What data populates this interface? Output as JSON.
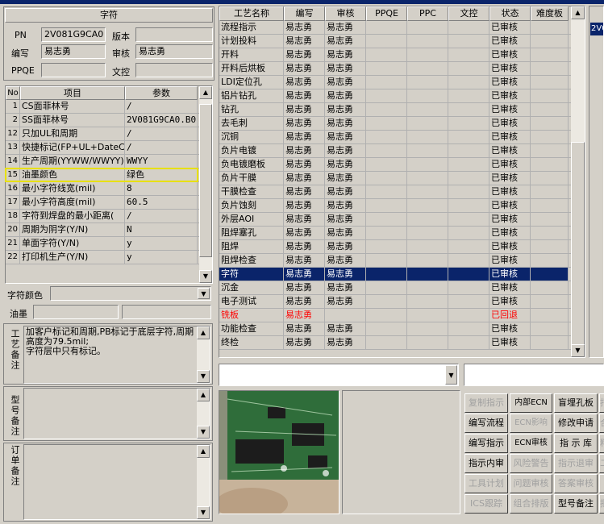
{
  "left_panel": {
    "title": "字符",
    "pn_label": "PN",
    "pn_value": "2V081G9CA0",
    "version_label": "版本",
    "version_value": "",
    "author_label": "编写",
    "author_value": "易志勇",
    "reviewer_label": "审核",
    "reviewer_value": "易志勇",
    "ppqe_label": "PPQE",
    "ppqe_value": "",
    "doc_control_label": "文控",
    "doc_control_value": ""
  },
  "param_table": {
    "headers": [
      "No",
      "项目",
      "参数"
    ],
    "rows": [
      {
        "no": "1",
        "item": "CS面菲林号",
        "value": "/"
      },
      {
        "no": "2",
        "item": "SS面菲林号",
        "value": "2V081G9CA0.B0"
      },
      {
        "no": "12",
        "item": "只加UL和周期",
        "value": "/"
      },
      {
        "no": "13",
        "item": "快捷标记(FP+UL+DateCo",
        "value": "/"
      },
      {
        "no": "14",
        "item": "生产周期(YYWW/WWYY)",
        "value": "WWYY"
      },
      {
        "no": "15",
        "item": "油墨颜色",
        "value": "绿色"
      },
      {
        "no": "16",
        "item": "最小字符线宽(mil)",
        "value": "8"
      },
      {
        "no": "17",
        "item": "最小字符高度(mil)",
        "value": "60.5"
      },
      {
        "no": "18",
        "item": "字符到焊盘的最小距离(",
        "value": "/"
      },
      {
        "no": "20",
        "item": "周期为阴字(Y/N)",
        "value": "N"
      },
      {
        "no": "21",
        "item": "单面字符(Y/N)",
        "value": "y"
      },
      {
        "no": "22",
        "item": "打印机生产(Y/N)",
        "value": "y"
      }
    ],
    "highlight_color": "#e8e000"
  },
  "char_color_label": "字符颜色",
  "char_color_value": "",
  "ink_label": "油墨",
  "ink_value_1": "",
  "ink_value_2": "",
  "process_note_label": "工艺备注",
  "process_note_text": "加客户标记和周期,PB标记于底层字符,周期高度为79.5mil;\n字符层中只有标记。",
  "model_note_label": "型号备注",
  "model_note_text": "",
  "order_note_label": "订单备注",
  "order_note_text": "",
  "process_table": {
    "headers": [
      "工艺名称",
      "编写",
      "审核",
      "PPQE",
      "PPC",
      "文控",
      "状态",
      "难度板"
    ],
    "rows": [
      {
        "name": "流程指示",
        "author": "易志勇",
        "reviewer": "易志勇",
        "ppqe": "",
        "ppc": "",
        "doc": "",
        "status": "已审核",
        "diff": "",
        "state": "normal"
      },
      {
        "name": "计划投料",
        "author": "易志勇",
        "reviewer": "易志勇",
        "ppqe": "",
        "ppc": "",
        "doc": "",
        "status": "已审核",
        "diff": "",
        "state": "normal"
      },
      {
        "name": "开料",
        "author": "易志勇",
        "reviewer": "易志勇",
        "ppqe": "",
        "ppc": "",
        "doc": "",
        "status": "已审核",
        "diff": "",
        "state": "normal"
      },
      {
        "name": "开料后烘板",
        "author": "易志勇",
        "reviewer": "易志勇",
        "ppqe": "",
        "ppc": "",
        "doc": "",
        "status": "已审核",
        "diff": "",
        "state": "normal"
      },
      {
        "name": "LDI定位孔",
        "author": "易志勇",
        "reviewer": "易志勇",
        "ppqe": "",
        "ppc": "",
        "doc": "",
        "status": "已审核",
        "diff": "",
        "state": "normal"
      },
      {
        "name": "铝片钻孔",
        "author": "易志勇",
        "reviewer": "易志勇",
        "ppqe": "",
        "ppc": "",
        "doc": "",
        "status": "已审核",
        "diff": "",
        "state": "normal"
      },
      {
        "name": "钻孔",
        "author": "易志勇",
        "reviewer": "易志勇",
        "ppqe": "",
        "ppc": "",
        "doc": "",
        "status": "已审核",
        "diff": "",
        "state": "normal"
      },
      {
        "name": "去毛刺",
        "author": "易志勇",
        "reviewer": "易志勇",
        "ppqe": "",
        "ppc": "",
        "doc": "",
        "status": "已审核",
        "diff": "",
        "state": "normal"
      },
      {
        "name": "沉铜",
        "author": "易志勇",
        "reviewer": "易志勇",
        "ppqe": "",
        "ppc": "",
        "doc": "",
        "status": "已审核",
        "diff": "",
        "state": "normal"
      },
      {
        "name": "负片电镀",
        "author": "易志勇",
        "reviewer": "易志勇",
        "ppqe": "",
        "ppc": "",
        "doc": "",
        "status": "已审核",
        "diff": "",
        "state": "normal"
      },
      {
        "name": "负电镀磨板",
        "author": "易志勇",
        "reviewer": "易志勇",
        "ppqe": "",
        "ppc": "",
        "doc": "",
        "status": "已审核",
        "diff": "",
        "state": "normal"
      },
      {
        "name": "负片干膜",
        "author": "易志勇",
        "reviewer": "易志勇",
        "ppqe": "",
        "ppc": "",
        "doc": "",
        "status": "已审核",
        "diff": "",
        "state": "normal"
      },
      {
        "name": "干膜检查",
        "author": "易志勇",
        "reviewer": "易志勇",
        "ppqe": "",
        "ppc": "",
        "doc": "",
        "status": "已审核",
        "diff": "",
        "state": "normal"
      },
      {
        "name": "负片蚀刻",
        "author": "易志勇",
        "reviewer": "易志勇",
        "ppqe": "",
        "ppc": "",
        "doc": "",
        "status": "已审核",
        "diff": "",
        "state": "normal"
      },
      {
        "name": "外层AOI",
        "author": "易志勇",
        "reviewer": "易志勇",
        "ppqe": "",
        "ppc": "",
        "doc": "",
        "status": "已审核",
        "diff": "",
        "state": "normal"
      },
      {
        "name": "阻焊塞孔",
        "author": "易志勇",
        "reviewer": "易志勇",
        "ppqe": "",
        "ppc": "",
        "doc": "",
        "status": "已审核",
        "diff": "",
        "state": "normal"
      },
      {
        "name": "阻焊",
        "author": "易志勇",
        "reviewer": "易志勇",
        "ppqe": "",
        "ppc": "",
        "doc": "",
        "status": "已审核",
        "diff": "",
        "state": "normal"
      },
      {
        "name": "阻焊检查",
        "author": "易志勇",
        "reviewer": "易志勇",
        "ppqe": "",
        "ppc": "",
        "doc": "",
        "status": "已审核",
        "diff": "",
        "state": "normal"
      },
      {
        "name": "字符",
        "author": "易志勇",
        "reviewer": "易志勇",
        "ppqe": "",
        "ppc": "",
        "doc": "",
        "status": "已审核",
        "diff": "",
        "state": "selected"
      },
      {
        "name": "沉金",
        "author": "易志勇",
        "reviewer": "易志勇",
        "ppqe": "",
        "ppc": "",
        "doc": "",
        "status": "已审核",
        "diff": "",
        "state": "normal"
      },
      {
        "name": "电子测试",
        "author": "易志勇",
        "reviewer": "易志勇",
        "ppqe": "",
        "ppc": "",
        "doc": "",
        "status": "已审核",
        "diff": "",
        "state": "normal"
      },
      {
        "name": "铣板",
        "author": "易志勇",
        "reviewer": "",
        "ppqe": "",
        "ppc": "",
        "doc": "",
        "status": "已回退",
        "diff": "",
        "state": "returned"
      },
      {
        "name": "功能检查",
        "author": "易志勇",
        "reviewer": "易志勇",
        "ppqe": "",
        "ppc": "",
        "doc": "",
        "status": "已审核",
        "diff": "",
        "state": "normal"
      },
      {
        "name": "终检",
        "author": "易志勇",
        "reviewer": "易志勇",
        "ppqe": "",
        "ppc": "",
        "doc": "",
        "status": "已审核",
        "diff": "",
        "state": "normal"
      }
    ]
  },
  "far_right_list_value": "2V0",
  "combo_1_value": "",
  "combo_2_value": "",
  "buttons": {
    "copy_instructions": "复制指示",
    "internal_ecn": "内部ECN",
    "blind_buried_holes": "盲埋孔板",
    "col4_r1": "打",
    "write_process": "编写流程",
    "ecn_impact": "ECN影响",
    "modify_request": "修改申请",
    "col4_r2": "合",
    "write_instructions": "编写指示",
    "ecn_review": "ECN审核",
    "instruction_library": "指 示 库",
    "col4_r3": "料",
    "instruction_internal_review": "指示内审",
    "risk_warning": "风险警告",
    "instruction_return": "指示退审",
    "col4_r4": "二",
    "tool_plan": "工具计划",
    "issue_review": "问题审核",
    "answer_review": "答案审核",
    "col4_r5": "",
    "ics_tracking": "ICS跟踪",
    "combined_layout": "组合排版",
    "model_remarks": "型号备注",
    "col4_r6": "批"
  },
  "colors": {
    "selection_bg": "#0a246a",
    "returned_text": "#ff0000",
    "title_blue": "#0a246a"
  }
}
